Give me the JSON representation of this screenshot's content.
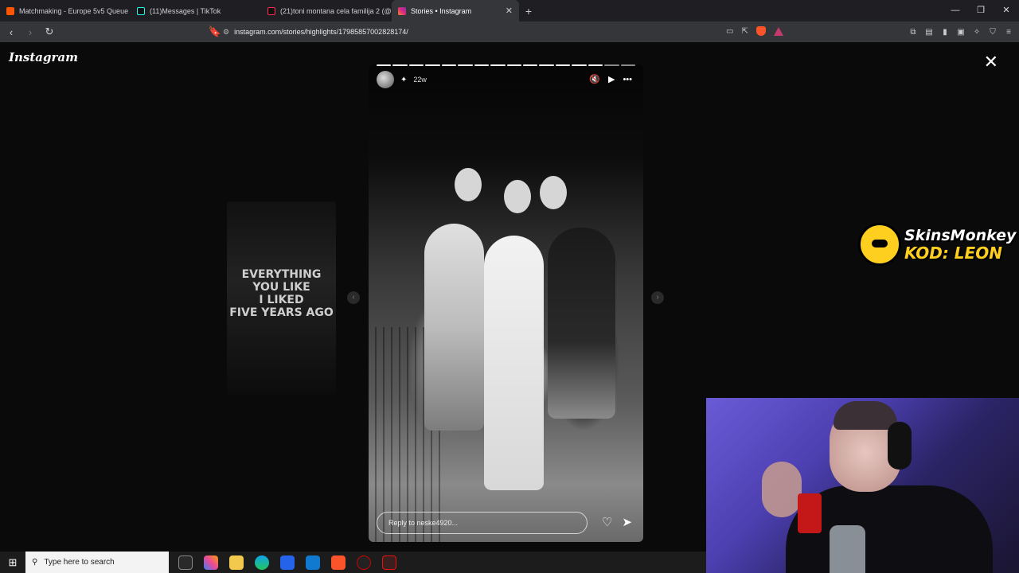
{
  "browser": {
    "tabs": [
      {
        "title": "Matchmaking - Europe 5v5 Queue - ",
        "active": false
      },
      {
        "title": "(11)Messages | TikTok",
        "active": false
      },
      {
        "title": "(21)toni montana cela familija 2 (@t",
        "active": false
      },
      {
        "title": "Stories • Instagram",
        "active": true
      }
    ],
    "new_tab": "+",
    "url": "instagram.com/stories/highlights/17985857002828174/"
  },
  "instagram": {
    "logo": "Instagram",
    "story": {
      "time_ago": "22w",
      "reply_placeholder": "Reply to neske4920..."
    },
    "side_story": {
      "line1": "EVERYTHING",
      "line2": "YOU LIKE",
      "line3": "I LIKED",
      "line4": "FIVE YEARS AGO"
    }
  },
  "overlay": {
    "sponsor_name": "SkinsMonkey",
    "sponsor_code": "KOD: LEON"
  },
  "taskbar": {
    "search_placeholder": "Type here to search"
  },
  "colors": {
    "accent_yellow": "#ffcf1f",
    "tab_bg": "#1f1f23",
    "active_tab": "#35363a"
  }
}
